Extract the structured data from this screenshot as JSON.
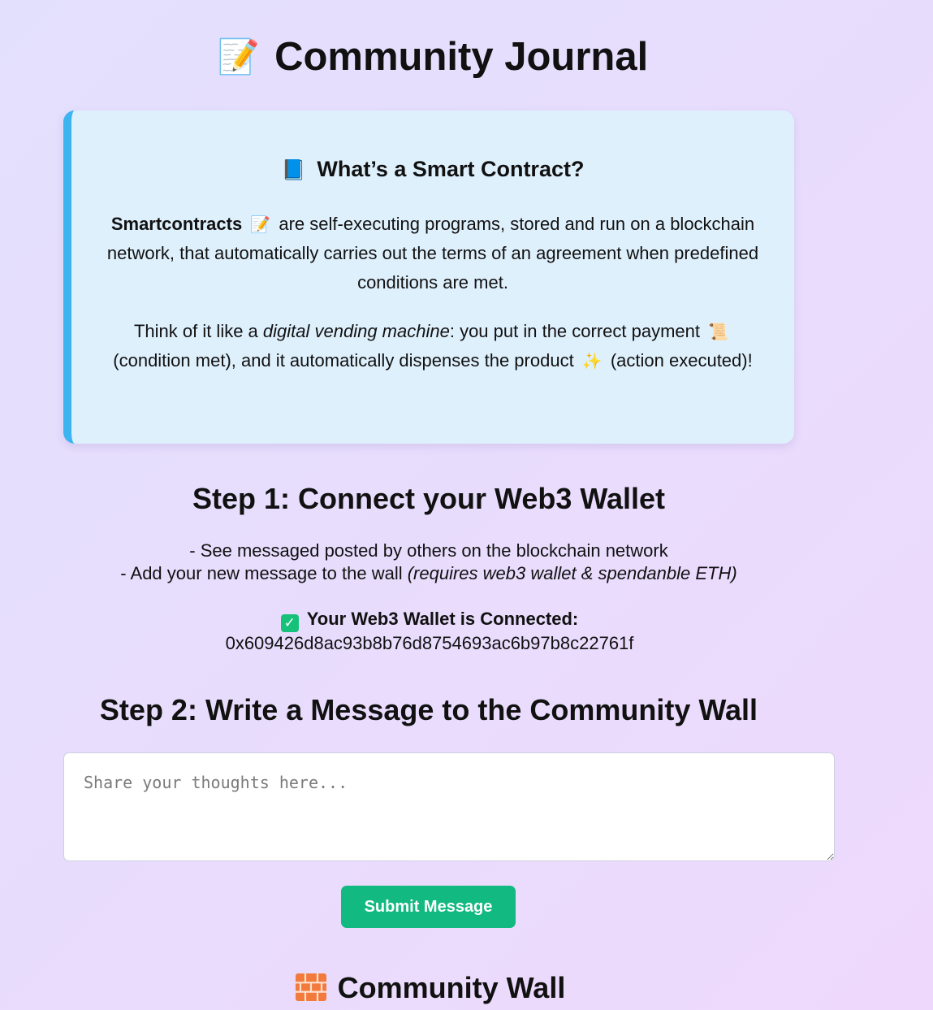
{
  "header": {
    "icon": "memo-icon",
    "icon_glyph": "📝",
    "title": "Community Journal"
  },
  "info_card": {
    "icon": "blue-book-icon",
    "icon_glyph": "📘",
    "title": "What’s a Smart Contract?",
    "p1_bold": "Smartcontracts",
    "p1_icon_glyph": "📝",
    "p1_rest": "are self-executing programs, stored and run on a blockchain network, that automatically carries out the terms of an agreement when predefined conditions are met.",
    "p2_start": "Think of it like a ",
    "p2_em": "digital vending machine",
    "p2_mid": ": you put in the correct payment",
    "p2_icon1_glyph": "📜",
    "p2_mid2": "(condition met), and it automatically dispenses the product",
    "p2_icon2_glyph": "✨",
    "p2_end": "(action executed)!",
    "accent_color": "#3bb4f0",
    "background_color": "#dff0fd"
  },
  "step1": {
    "heading": "Step 1: Connect your Web3 Wallet",
    "line1": "- See messaged posted by others on the blockchain network",
    "line2_start": "- Add your new message to the wall ",
    "line2_em": "(requires web3 wallet & spendanble ETH)",
    "wallet_check_glyph": "✓",
    "wallet_label": "Your Web3 Wallet is Connected:",
    "wallet_address": "0x609426d8ac93b8b76d8754693ac6b97b8c22761f"
  },
  "step2": {
    "heading": "Step 2: Write a Message to the Community Wall",
    "input_value": "",
    "input_placeholder": "Share your thoughts here...",
    "submit_label": "Submit Message",
    "submit_color": "#12b981"
  },
  "wall": {
    "icon": "brick-icon",
    "heading": "Community Wall"
  }
}
